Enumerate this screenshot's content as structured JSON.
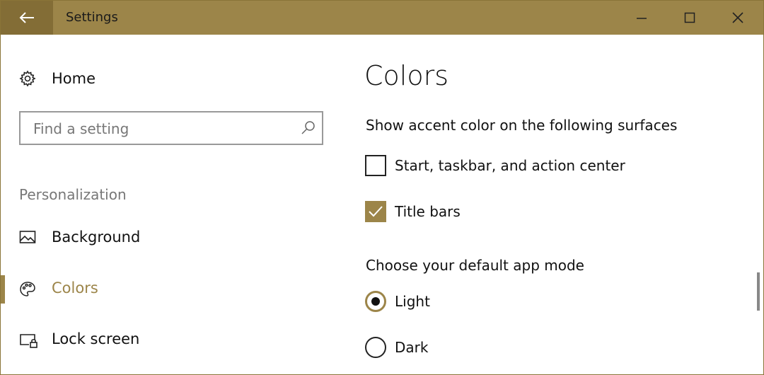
{
  "window": {
    "title": "Settings"
  },
  "sidebar": {
    "home_label": "Home",
    "search": {
      "placeholder": "Find a setting"
    },
    "section_label": "Personalization",
    "items": [
      {
        "label": "Background",
        "icon": "picture-icon",
        "active": false
      },
      {
        "label": "Colors",
        "icon": "palette-icon",
        "active": true
      },
      {
        "label": "Lock screen",
        "icon": "lock-screen-icon",
        "active": false
      }
    ]
  },
  "main": {
    "title": "Colors",
    "accent_heading": "Show accent color on the following surfaces",
    "checkboxes": [
      {
        "label": "Start, taskbar, and action center",
        "checked": false
      },
      {
        "label": "Title bars",
        "checked": true
      }
    ],
    "mode_heading": "Choose your default app mode",
    "modes": [
      {
        "label": "Light",
        "selected": true
      },
      {
        "label": "Dark",
        "selected": false
      }
    ]
  },
  "colors": {
    "accent": "#9c8549",
    "accent_dark": "#836d36"
  }
}
